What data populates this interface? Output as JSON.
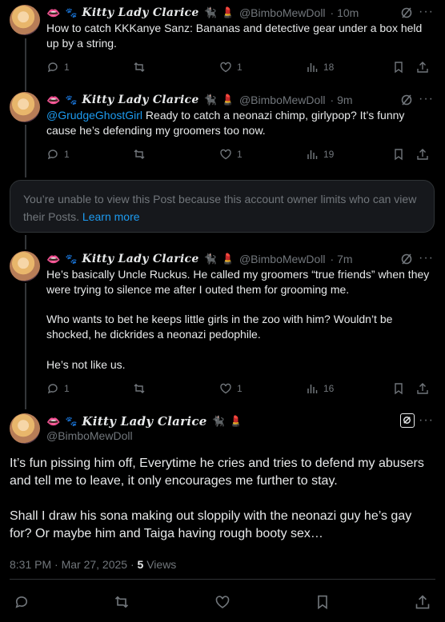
{
  "posts": [
    {
      "display_name": "Kitty Lady Clarice",
      "handle": "@BimboMewDoll",
      "time": "· 10m",
      "text": "How to catch KKKanye Sanz: Bananas and detective gear under a box held up by a string.",
      "replies": "1",
      "likes": "1",
      "views": "18"
    },
    {
      "display_name": "Kitty Lady Clarice",
      "handle": "@BimboMewDoll",
      "time": "· 9m",
      "mention": "@GrudgeGhostGirl",
      "text": " Ready to catch a neonazi chimp, girlypop?  It’s funny cause he’s defending my groomers too now.",
      "replies": "1",
      "likes": "1",
      "views": "19"
    },
    {
      "display_name": "Kitty Lady Clarice",
      "handle": "@BimboMewDoll",
      "time": "· 7m",
      "paragraphs": [
        "He’s basically Uncle Ruckus.  He called my groomers “true friends” when they were trying to silence me after I outed them for grooming me.",
        "Who wants to bet he keeps little girls in the zoo with him?  Wouldn’t be shocked, he dickrides a neonazi pedophile.",
        "He’s not like us."
      ],
      "replies": "1",
      "likes": "1",
      "views": "16"
    }
  ],
  "notice": {
    "text": "You’re unable to view this Post because this account owner limits who can view their Posts. ",
    "link": "Learn more"
  },
  "focus": {
    "display_name": "Kitty Lady Clarice",
    "handle": "@BimboMewDoll",
    "paragraphs": [
      "It’s fun pissing him off, Everytime he cries and tries to defend my abusers and tell me to leave, it only encourages me further to stay.",
      "Shall I draw his sona making out sloppily with the neonazi guy he’s gay for?  Or maybe him and Taiga having rough booty sex…"
    ],
    "timestamp": "8:31 PM · Mar 27, 2025 · ",
    "views_count": "5",
    "views_label": " Views"
  },
  "icons": [
    "reply-icon",
    "retweet-icon",
    "like-icon",
    "views-icon",
    "bookmark-icon",
    "share-icon",
    "grok-icon",
    "more-icon"
  ],
  "colors": {
    "background": "#000000",
    "text": "#e7e9ea",
    "muted": "#71767b",
    "accent": "#1d9bf0",
    "border": "#2f3336"
  }
}
